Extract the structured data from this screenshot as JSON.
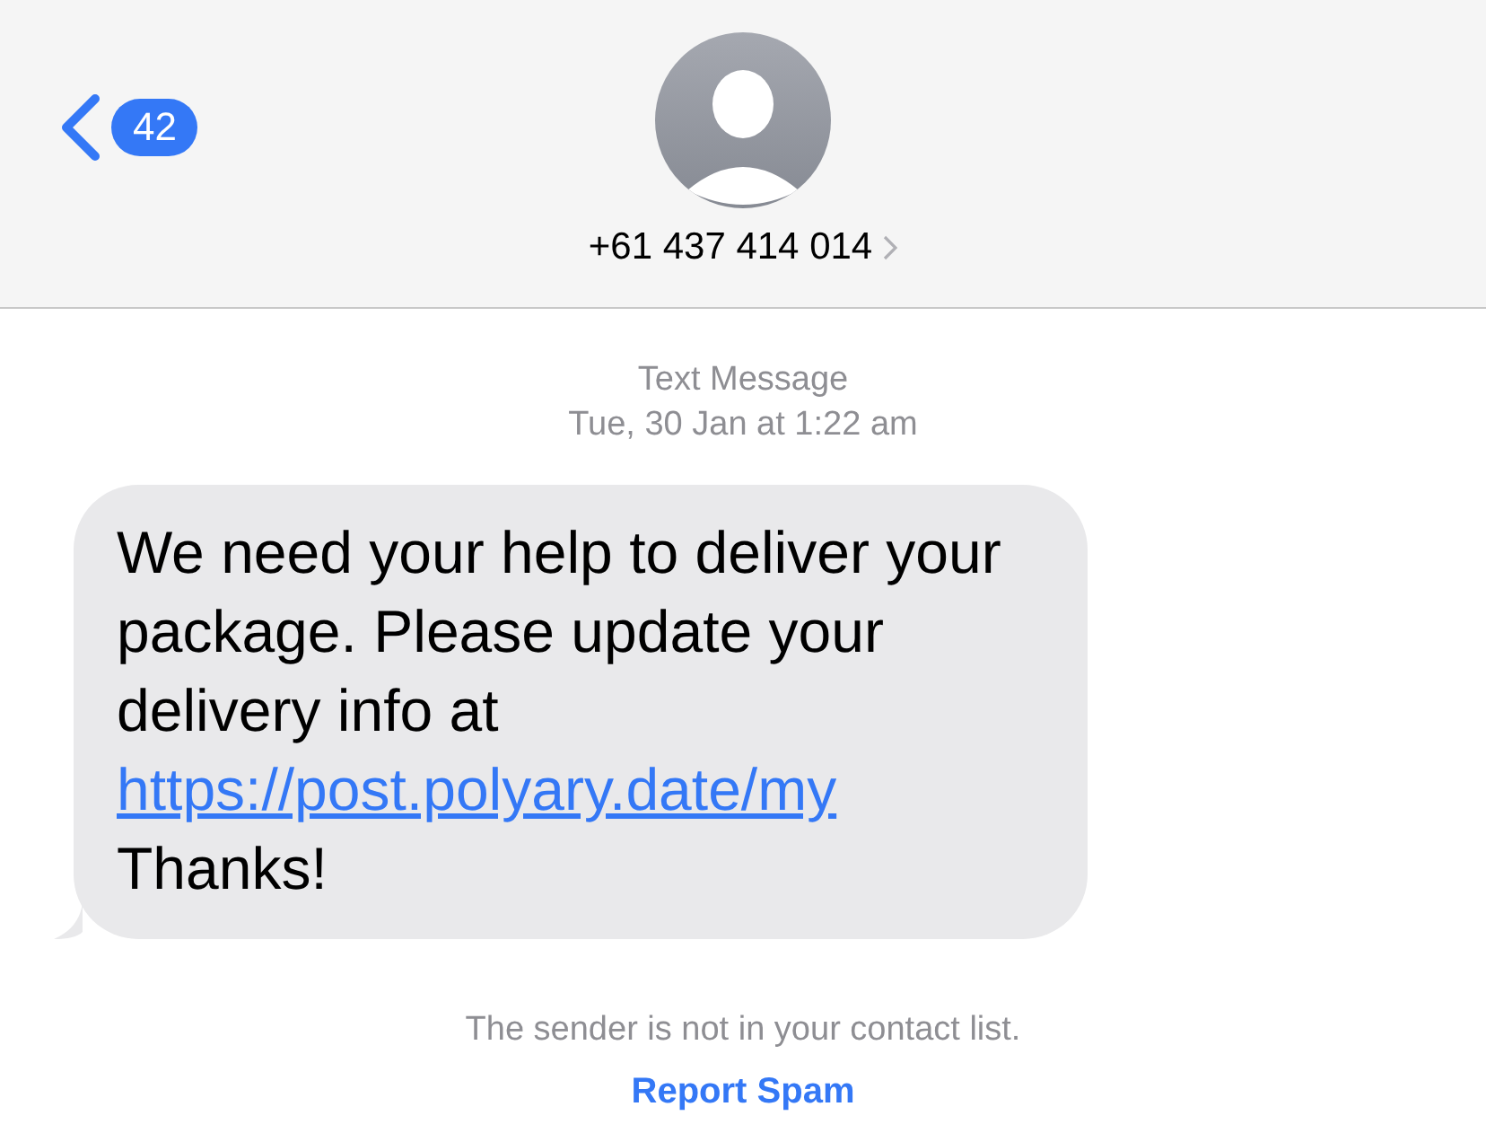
{
  "header": {
    "back_badge": "42",
    "contact": "+61 437 414 014"
  },
  "conversation": {
    "service": "Text Message",
    "timestamp": "Tue, 30 Jan at 1:22 am",
    "message": [
      {
        "kind": "text",
        "text": "We need your help to deliver your package. Please update your delivery info at "
      },
      {
        "kind": "link",
        "text": "https://post.polyary.date/my"
      },
      {
        "kind": "text",
        "text": " Thanks!"
      }
    ]
  },
  "footer": {
    "notice": "The sender is not in your contact list.",
    "action": "Report Spam"
  }
}
